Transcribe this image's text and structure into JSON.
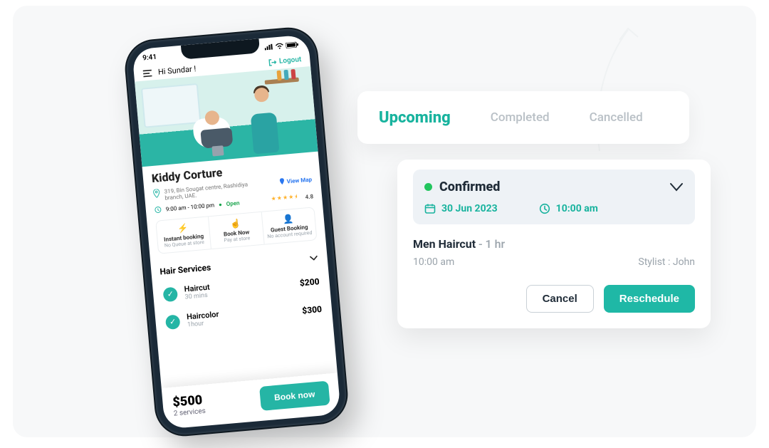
{
  "phone": {
    "status_time": "9:41",
    "greeting": "Hi Sundar !",
    "logout": "Logout",
    "shop": {
      "name": "Kiddy Corture",
      "address": "319, Bin Sougat centre, Rashidiya branch, UAE.",
      "view_map": "View Map",
      "hours": "9:00 am - 10:00 pm",
      "status": "Open",
      "rating": "4.8"
    },
    "pills": [
      {
        "title": "Instant booking",
        "sub": "No Queue at store"
      },
      {
        "title": "Book Now",
        "sub": "Pay at store"
      },
      {
        "title": "Guest Booking",
        "sub": "No account required"
      }
    ],
    "services_header": "Hair Services",
    "services": [
      {
        "name": "Haircut",
        "duration": "30 mins",
        "price": "$200"
      },
      {
        "name": "Haircolor",
        "duration": "1hour",
        "price": "$300"
      }
    ],
    "total": "$500",
    "services_count": "2 services",
    "book_now": "Book now"
  },
  "tabs": {
    "upcoming": "Upcoming",
    "completed": "Completed",
    "cancelled": "Cancelled"
  },
  "booking": {
    "status": "Confirmed",
    "date": "30 Jun 2023",
    "time": "10:00 am",
    "service": "Men Haircut",
    "duration": "- 1 hr",
    "slot_time": "10:00 am",
    "stylist_label": "Stylist : John",
    "cancel": "Cancel",
    "reschedule": "Reschedule"
  }
}
